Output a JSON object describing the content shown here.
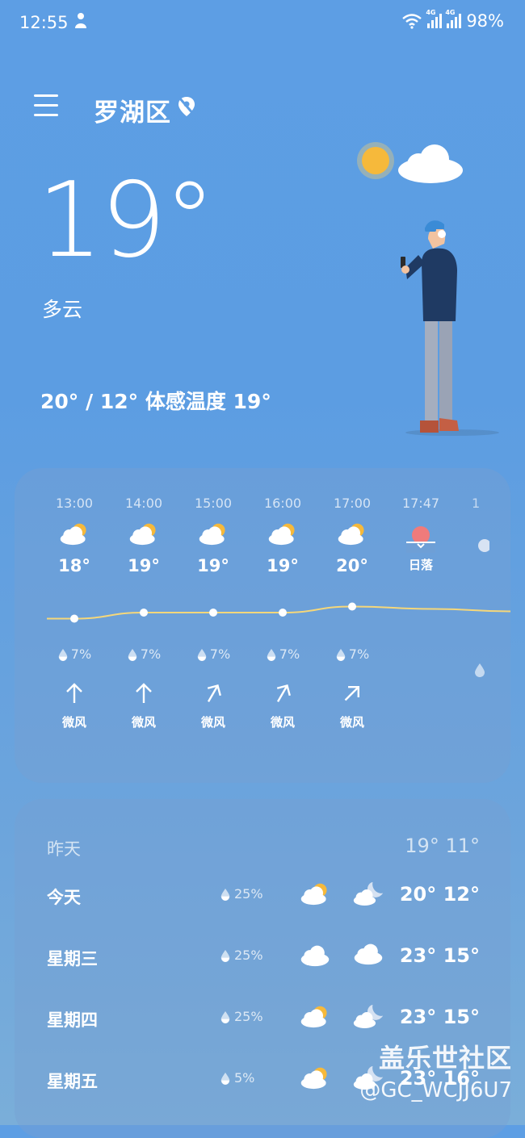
{
  "status_bar": {
    "time": "12:55",
    "battery": "98%",
    "network_label": "4G"
  },
  "header": {
    "location": "罗湖区"
  },
  "current": {
    "temperature": "19°",
    "condition": "多云",
    "range_feels": "20° / 12° 体感温度 19°"
  },
  "hourly": [
    {
      "time": "13:00",
      "temp": "18°",
      "precip": "7%",
      "wind": "微风",
      "wind_dir_deg": 0
    },
    {
      "time": "14:00",
      "temp": "19°",
      "precip": "7%",
      "wind": "微风",
      "wind_dir_deg": 0
    },
    {
      "time": "15:00",
      "temp": "19°",
      "precip": "7%",
      "wind": "微风",
      "wind_dir_deg": 30
    },
    {
      "time": "16:00",
      "temp": "19°",
      "precip": "7%",
      "wind": "微风",
      "wind_dir_deg": 30
    },
    {
      "time": "17:00",
      "temp": "20°",
      "precip": "7%",
      "wind": "微风",
      "wind_dir_deg": 45
    }
  ],
  "sunset": {
    "time": "17:47",
    "label": "日落"
  },
  "daily_yesterday": {
    "label": "昨天",
    "temps": "19° 11°"
  },
  "daily": [
    {
      "day": "今天",
      "precip": "25%",
      "temps": "20° 12°",
      "day_icon": "partly-cloudy",
      "night_icon": "cloudy-night"
    },
    {
      "day": "星期三",
      "precip": "25%",
      "temps": "23° 15°",
      "day_icon": "cloudy",
      "night_icon": "cloudy"
    },
    {
      "day": "星期四",
      "precip": "25%",
      "temps": "23° 15°",
      "day_icon": "partly-cloudy",
      "night_icon": "cloudy-night"
    },
    {
      "day": "星期五",
      "precip": "5%",
      "temps": "23° 16°",
      "day_icon": "partly-cloudy",
      "night_icon": "cloudy-night"
    }
  ],
  "watermark": {
    "title": "盖乐世社区",
    "user": "@GC_WCJJ6U7"
  },
  "colors": {
    "sun": "#f6b93b",
    "temp_line": "#f5d77a",
    "sunset": "#f07b7b"
  }
}
